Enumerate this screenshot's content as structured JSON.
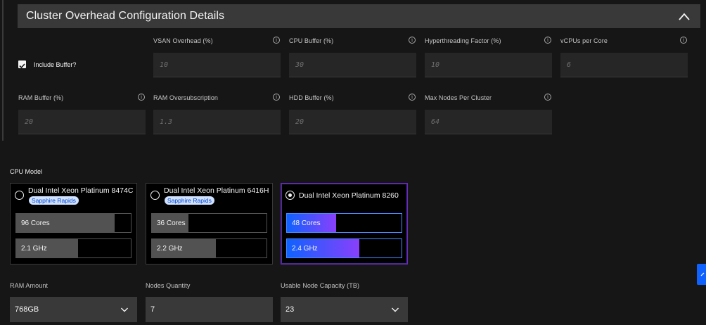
{
  "accordion": {
    "title": "Cluster Overhead Configuration Details"
  },
  "include_buffer": {
    "label": "Include Buffer?",
    "checked": true
  },
  "fields_row1": [
    {
      "label": "VSAN Overhead (%)",
      "placeholder": "10"
    },
    {
      "label": "CPU Buffer (%)",
      "placeholder": "30"
    },
    {
      "label": "Hyperthreading Factor (%)",
      "placeholder": "10"
    },
    {
      "label": "vCPUs per Core",
      "placeholder": "6"
    }
  ],
  "fields_row2": [
    {
      "label": "RAM Buffer (%)",
      "placeholder": "20"
    },
    {
      "label": "RAM Oversubscription",
      "placeholder": "1.3"
    },
    {
      "label": "HDD Buffer (%)",
      "placeholder": "20"
    },
    {
      "label": "Max Nodes Per Cluster",
      "placeholder": "64"
    }
  ],
  "info_glyph": "i",
  "cpu_model": {
    "label": "CPU Model",
    "cards": [
      {
        "title": "Dual Intel Xeon Platinum 8474C",
        "tag": "Sapphire Rapids",
        "selected": false,
        "cores": "96 Cores",
        "cores_fraction": 0.86,
        "freq": "2.1 GHz",
        "freq_fraction": 0.54
      },
      {
        "title": "Dual Intel Xeon Platinum 6416H",
        "tag": "Sapphire Rapids",
        "selected": false,
        "cores": "36 Cores",
        "cores_fraction": 0.32,
        "freq": "2.2 GHz",
        "freq_fraction": 0.56
      },
      {
        "title": "Dual Intel Xeon Platinum 8260",
        "tag": "",
        "selected": true,
        "cores": "48 Cores",
        "cores_fraction": 0.43,
        "freq": "2.4 GHz",
        "freq_fraction": 0.63
      }
    ]
  },
  "bottom": {
    "ram_amount": {
      "label": "RAM Amount",
      "value": "768GB"
    },
    "nodes_quantity": {
      "label": "Nodes Quantity",
      "value": "7"
    },
    "usable_capacity": {
      "label": "Usable Node Capacity (TB)",
      "value": "23"
    }
  },
  "colors": {
    "accent": "#0f62fe",
    "selected_border": "#6929c4",
    "tag_bg": "#d0e2ff"
  }
}
